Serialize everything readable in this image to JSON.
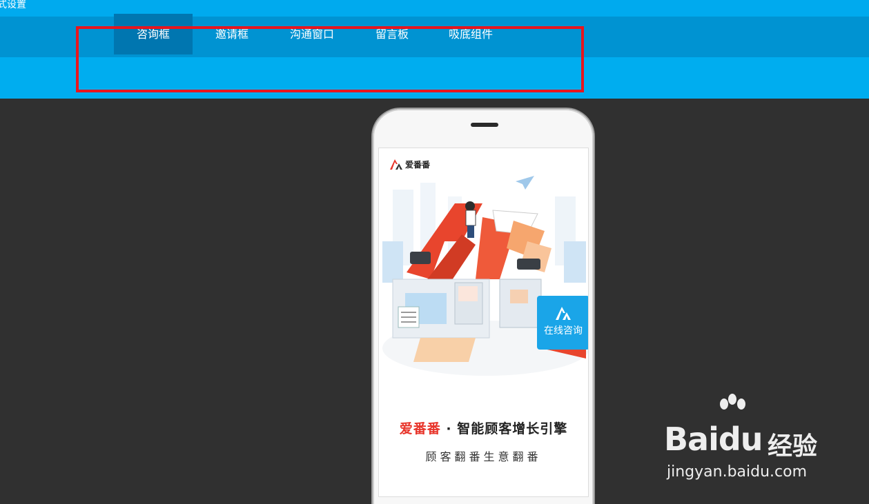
{
  "window": {
    "title": "式设置"
  },
  "nav": {
    "tabs": [
      {
        "label": "咨询框",
        "active": true
      },
      {
        "label": "邀请框",
        "active": false
      },
      {
        "label": "沟通窗口",
        "active": false
      },
      {
        "label": "留言板",
        "active": false
      },
      {
        "label": "吸底组件",
        "active": false
      }
    ]
  },
  "preview": {
    "brand": {
      "name": "爱番番",
      "icon": "aifanfan-logo-icon"
    },
    "consult_button": {
      "label": "在线咨询",
      "icon": "aifanfan-logo-icon"
    },
    "headline": {
      "brand": "爱番番",
      "separator": " · ",
      "text": "智能顾客增长引擎"
    },
    "tagline": "顾客翻番生意翻番"
  },
  "watermark": {
    "logo": "Bai",
    "logo_suffix": "du",
    "brand_cn": "经验",
    "url": "jingyan.baidu.com"
  },
  "colors": {
    "top_bar": "#00aaee",
    "nav_bar": "#0093d2",
    "active_tab": "#0076b0",
    "highlight": "#e8151d",
    "consult_button": "#1aa5e8",
    "brand_red": "#e8352b"
  }
}
